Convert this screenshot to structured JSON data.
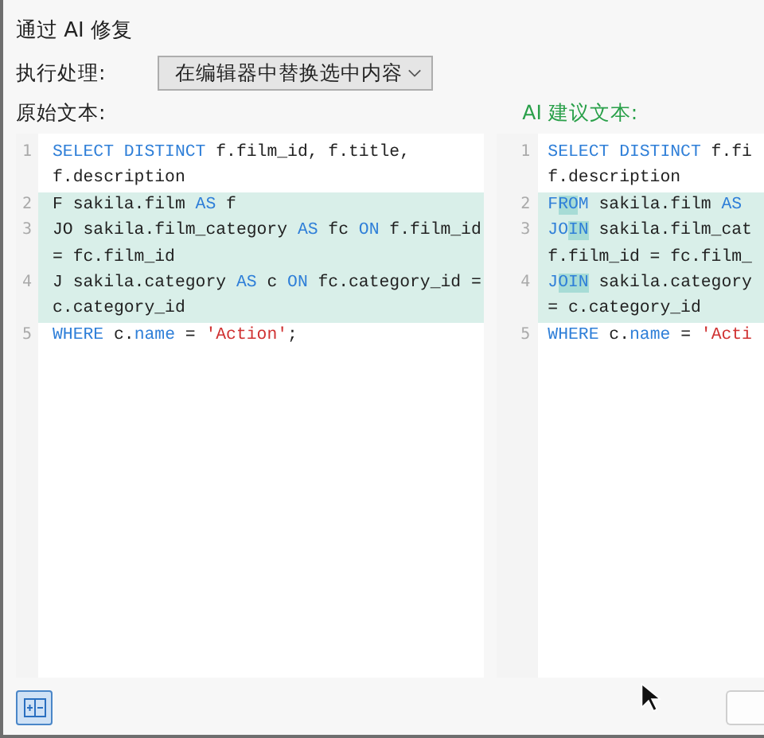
{
  "dialog": {
    "title": "通过 AI 修复"
  },
  "action": {
    "label": "执行处理:",
    "value": "在编辑器中替换选中内容"
  },
  "panes": [
    {
      "kind": "original",
      "label": "原始文本:",
      "lines": [
        {
          "number": "1",
          "modified": false,
          "rows": [
            [
              {
                "text": "SELECT DISTINCT",
                "kind": "kw"
              },
              {
                "text": " f.film_id, f.title,",
                "kind": "plain"
              }
            ],
            [
              {
                "text": "f.description",
                "kind": "plain"
              }
            ]
          ]
        },
        {
          "number": "2",
          "modified": true,
          "rows": [
            [
              {
                "text": "F sakila.film ",
                "kind": "plain"
              },
              {
                "text": "AS",
                "kind": "kw"
              },
              {
                "text": " f",
                "kind": "plain"
              }
            ]
          ]
        },
        {
          "number": "3",
          "modified": true,
          "rows": [
            [
              {
                "text": "JO sakila.film_category ",
                "kind": "plain"
              },
              {
                "text": "AS",
                "kind": "kw"
              },
              {
                "text": " fc ",
                "kind": "plain"
              },
              {
                "text": "ON",
                "kind": "kw"
              },
              {
                "text": " f.film_id",
                "kind": "plain"
              }
            ],
            [
              {
                "text": "= fc.film_id",
                "kind": "plain"
              }
            ]
          ]
        },
        {
          "number": "4",
          "modified": true,
          "rows": [
            [
              {
                "text": "J sakila.category ",
                "kind": "plain"
              },
              {
                "text": "AS",
                "kind": "kw"
              },
              {
                "text": " c ",
                "kind": "plain"
              },
              {
                "text": "ON",
                "kind": "kw"
              },
              {
                "text": " fc.category_id =",
                "kind": "plain"
              }
            ],
            [
              {
                "text": "c.category_id",
                "kind": "plain"
              }
            ]
          ]
        },
        {
          "number": "5",
          "modified": false,
          "rows": [
            [
              {
                "text": "WHERE",
                "kind": "kw"
              },
              {
                "text": " c.",
                "kind": "plain"
              },
              {
                "text": "name",
                "kind": "kw"
              },
              {
                "text": " = ",
                "kind": "plain"
              },
              {
                "text": "'Action'",
                "kind": "str"
              },
              {
                "text": ";",
                "kind": "plain"
              }
            ]
          ]
        }
      ]
    },
    {
      "kind": "suggested",
      "label": "AI 建议文本:",
      "lines": [
        {
          "number": "1",
          "modified": false,
          "rows": [
            [
              {
                "text": "SELECT DISTINCT",
                "kind": "kw"
              },
              {
                "text": " f.fi",
                "kind": "plain"
              }
            ],
            [
              {
                "text": "f.description",
                "kind": "plain"
              }
            ]
          ]
        },
        {
          "number": "2",
          "modified": true,
          "rows": [
            [
              {
                "text": "F",
                "kind": "kw"
              },
              {
                "text": "RO",
                "kind": "kw",
                "changed": true
              },
              {
                "text": "M",
                "kind": "kw"
              },
              {
                "text": " sakila.film ",
                "kind": "plain"
              },
              {
                "text": "AS",
                "kind": "kw"
              }
            ]
          ]
        },
        {
          "number": "3",
          "modified": true,
          "rows": [
            [
              {
                "text": "JO",
                "kind": "kw"
              },
              {
                "text": "IN",
                "kind": "kw",
                "changed": true
              },
              {
                "text": " sakila.film_cat",
                "kind": "plain"
              }
            ],
            [
              {
                "text": "f.film_id = fc.film_",
                "kind": "plain"
              }
            ]
          ]
        },
        {
          "number": "4",
          "modified": true,
          "rows": [
            [
              {
                "text": "J",
                "kind": "kw"
              },
              {
                "text": "OIN",
                "kind": "kw",
                "changed": true
              },
              {
                "text": " sakila.category",
                "kind": "plain"
              }
            ],
            [
              {
                "text": "= c.category_id",
                "kind": "plain"
              }
            ]
          ]
        },
        {
          "number": "5",
          "modified": false,
          "rows": [
            [
              {
                "text": "WHERE",
                "kind": "kw"
              },
              {
                "text": " c.",
                "kind": "plain"
              },
              {
                "text": "name",
                "kind": "kw"
              },
              {
                "text": " = ",
                "kind": "plain"
              },
              {
                "text": "'Acti",
                "kind": "str"
              }
            ]
          ]
        }
      ]
    }
  ]
}
